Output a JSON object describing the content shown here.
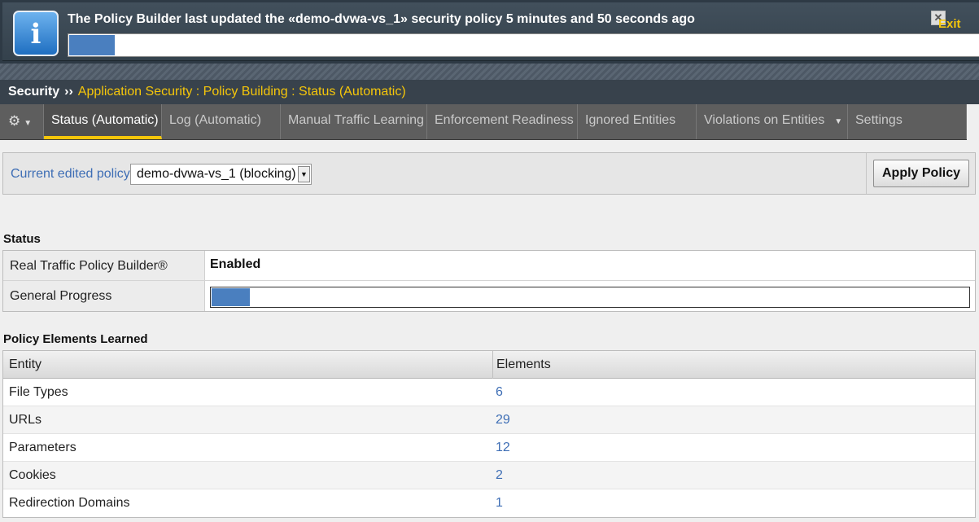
{
  "banner": {
    "message": "The Policy Builder last updated the «demo-dvwa-vs_1» security policy 5 minutes and 50 seconds ago",
    "progress_fraction": 0.05,
    "exit_label": "Exit",
    "close_glyph": "✕"
  },
  "breadcrumb": {
    "root": "Security",
    "separator": "››",
    "path": "Application Security : Policy Building : Status (Automatic)"
  },
  "tabs": [
    {
      "label": "Status (Automatic)",
      "active": true
    },
    {
      "label": "Log (Automatic)",
      "active": false
    },
    {
      "label": "Manual Traffic Learning",
      "active": false
    },
    {
      "label": "Enforcement Readiness",
      "active": false
    },
    {
      "label": "Ignored Entities",
      "active": false
    },
    {
      "label": "Violations on Entities",
      "active": false,
      "has_dropdown": true
    },
    {
      "label": "Settings",
      "active": false
    }
  ],
  "policy": {
    "label": "Current edited policy",
    "selected": "demo-dvwa-vs_1 (blocking)",
    "apply_label": "Apply Policy"
  },
  "status": {
    "title": "Status",
    "rows": [
      {
        "label": "Real Traffic Policy Builder®",
        "value": "Enabled"
      },
      {
        "label": "General Progress",
        "progress_fraction": 0.05
      }
    ]
  },
  "elements": {
    "title": "Policy Elements Learned",
    "columns": [
      "Entity",
      "Elements"
    ],
    "rows": [
      {
        "entity": "File Types",
        "count": "6"
      },
      {
        "entity": "URLs",
        "count": "29"
      },
      {
        "entity": "Parameters",
        "count": "12"
      },
      {
        "entity": "Cookies",
        "count": "2"
      },
      {
        "entity": "Redirection Domains",
        "count": "1"
      }
    ]
  },
  "colors": {
    "accent_yellow": "#f5c60a",
    "link_blue": "#3e6eb5",
    "progress_blue": "#4a7fbf"
  }
}
